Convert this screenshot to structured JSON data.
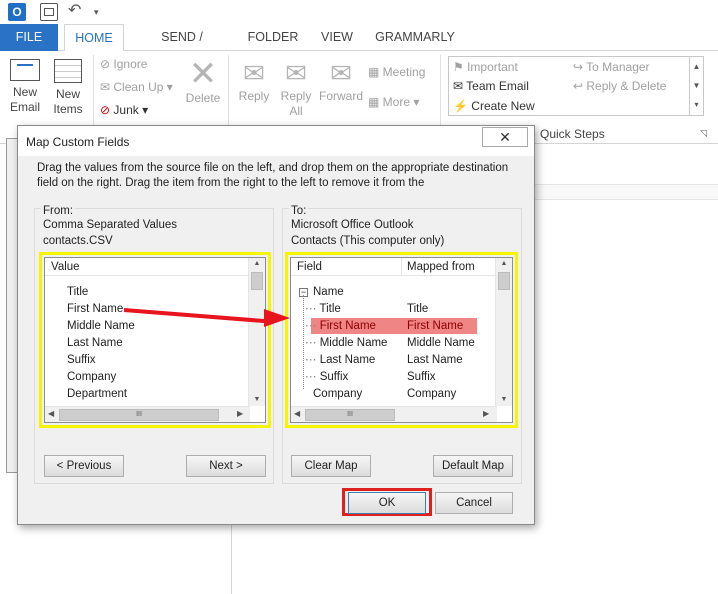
{
  "tabs": [
    "FILE",
    "HOME",
    "SEND / RECEIVE",
    "FOLDER",
    "VIEW",
    "GRAMMARLY"
  ],
  "ribbon": {
    "new_email": [
      "New",
      "Email"
    ],
    "new_items": [
      "New",
      "Items"
    ],
    "ignore": "Ignore",
    "clean_up": "Clean Up",
    "junk": "Junk",
    "delete": "Delete",
    "reply": "Reply",
    "reply_all": [
      "Reply",
      "All"
    ],
    "forward": "Forward",
    "meeting": "Meeting",
    "more": "More"
  },
  "quick_steps": {
    "group_label": "Quick Steps",
    "items": [
      "Important",
      "Team Email",
      "Create New",
      "To Manager",
      "Reply & Delete"
    ]
  },
  "dialog": {
    "title": "Map Custom Fields",
    "close": "✕",
    "instructions": "Drag the values from the source file on the left, and drop them on the appropriate destination field on the right.  Drag the item from the right to the left to remove it from the",
    "from_label": "From:",
    "from_source": "Comma Separated Values",
    "from_file": "contacts.CSV",
    "to_label": "To:",
    "to_target": "Microsoft Office Outlook",
    "to_folder": "Contacts (This computer only)",
    "left_header": "Value",
    "left_values": [
      "Title",
      "First Name",
      "Middle Name",
      "Last Name",
      "Suffix",
      "Company",
      "Department"
    ],
    "right_headers": [
      "Field",
      "Mapped from"
    ],
    "right_group": "Name",
    "right_rows": [
      {
        "field": "Title",
        "mapped": "Title"
      },
      {
        "field": "First Name",
        "mapped": "First Name"
      },
      {
        "field": "Middle Name",
        "mapped": "Middle Name"
      },
      {
        "field": "Last Name",
        "mapped": "Last Name"
      },
      {
        "field": "Suffix",
        "mapped": "Suffix"
      },
      {
        "field": "Company",
        "mapped": "Company"
      }
    ],
    "previous": "< Previous",
    "next": "Next >",
    "clear_map": "Clear Map",
    "default_map": "Default Map",
    "ok": "OK",
    "cancel": "Cancel",
    "hscroll_grip": "III"
  },
  "colors": {
    "accent": "#2a72c5",
    "highlight_row": "#f08585",
    "yellow_box": "#f5f500",
    "red_box": "#e0201f",
    "arrow": "#e8141e"
  }
}
